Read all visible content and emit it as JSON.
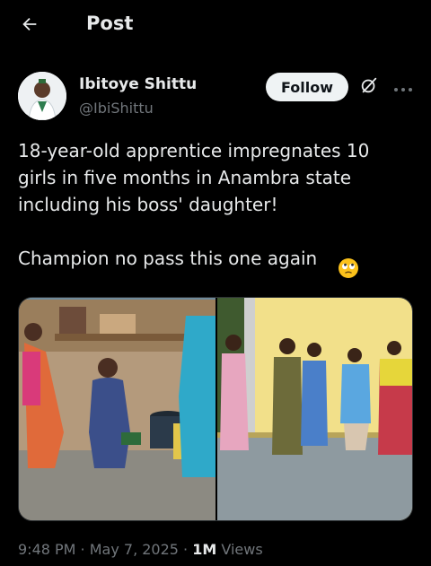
{
  "header": {
    "title": "Post",
    "back_icon": "arrow-left-icon"
  },
  "author": {
    "name": "Ibitoye Shittu",
    "handle": "@IbiShittu",
    "follow_label": "Follow",
    "grok_icon": "grok-icon",
    "more_icon": "more-icon"
  },
  "tweet": {
    "text": "18-year-old apprentice impregnates 10\ngirls in five months in Anambra state\nincluding his boss' daughter!\n\nChampion no pass this one again",
    "emoji": "face-with-rolling-eyes-emoji"
  },
  "meta": {
    "time": "9:48 PM",
    "separator": " · ",
    "date": "May 7, 2025",
    "views_count": "1M",
    "views_label": " Views"
  },
  "colors": {
    "background": "#000000",
    "text_primary": "#e7e9ea",
    "text_secondary": "#71767b",
    "follow_bg": "#eff3f4"
  }
}
